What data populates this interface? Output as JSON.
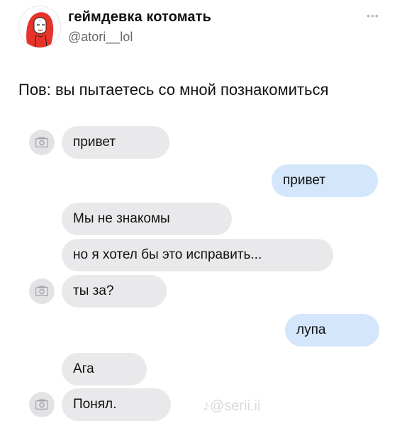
{
  "author": {
    "name": "геймдевка котомать",
    "handle": "@atori__lol"
  },
  "tweet": {
    "text": "Пов: вы пытаетесь со мной познакомиться"
  },
  "chat": {
    "messages": [
      {
        "side": "in",
        "text": "привет",
        "camera": true
      },
      {
        "side": "out",
        "text": "привет",
        "camera": false
      },
      {
        "side": "in",
        "text": "Мы не знакомы",
        "camera": false
      },
      {
        "side": "in",
        "text": "но я хотел бы это исправить...",
        "camera": false
      },
      {
        "side": "in",
        "text": "ты за?",
        "camera": true
      },
      {
        "side": "out",
        "text": "лупа",
        "camera": false
      },
      {
        "side": "in",
        "text": "Ага",
        "camera": false
      },
      {
        "side": "in",
        "text": "Понял.",
        "camera": true
      }
    ]
  },
  "watermark": "♪@serii.ii",
  "icons": {
    "avatar": "red-haired-woman-avatar",
    "more": "more-dots-icon",
    "camera": "camera-icon"
  },
  "colors": {
    "incoming_bubble": "#e9e9eb",
    "outgoing_bubble": "#d3e6fb",
    "camera_circle": "#e3e3e6"
  }
}
